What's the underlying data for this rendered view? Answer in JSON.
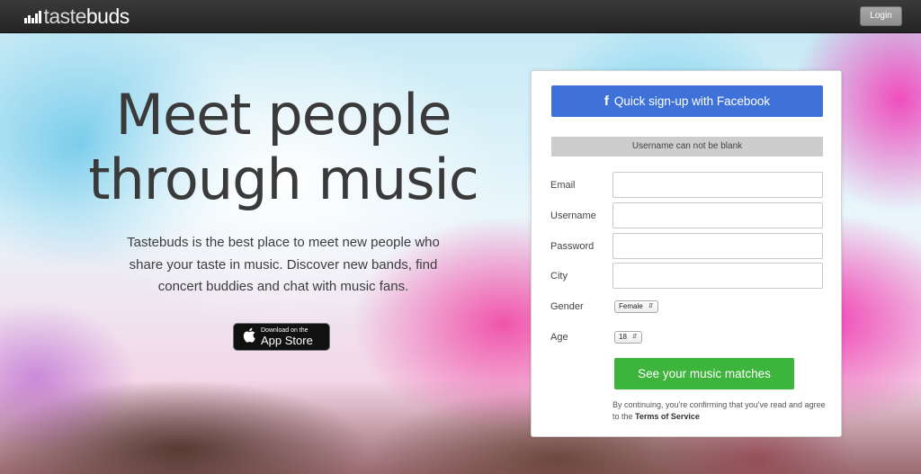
{
  "header": {
    "logo_light": "taste",
    "logo_strong": "buds",
    "login_label": "Login"
  },
  "hero": {
    "headline_line1": "Meet people",
    "headline_line2": "through music",
    "description_line1": "Tastebuds is the best place to meet new people who",
    "description_line2": "share your taste in music. Discover new bands, find",
    "description_line3": "concert buddies and chat with music fans.",
    "appstore_small": "Download on the",
    "appstore_big": "App Store"
  },
  "signup": {
    "facebook_icon": "f",
    "facebook_label": "Quick sign-up with Facebook",
    "error_message": "Username can not be blank",
    "fields": {
      "email_label": "Email",
      "email_value": "",
      "username_label": "Username",
      "username_value": "",
      "password_label": "Password",
      "password_value": "",
      "city_label": "City",
      "city_value": "",
      "gender_label": "Gender",
      "gender_value": "Female",
      "age_label": "Age",
      "age_value": "18"
    },
    "submit_label": "See your music matches",
    "terms_prefix": "By continuing, you're confirming that you've read and agree to the",
    "terms_link": "Terms of Service"
  },
  "colors": {
    "facebook_blue": "#3f72d9",
    "submit_green": "#3db43b",
    "topbar": "#2b2b2b"
  },
  "icons": {
    "logo_mark": "equalizer-bars-icon",
    "apple": "apple-icon",
    "select_arrow": "updown-arrow-icon"
  }
}
